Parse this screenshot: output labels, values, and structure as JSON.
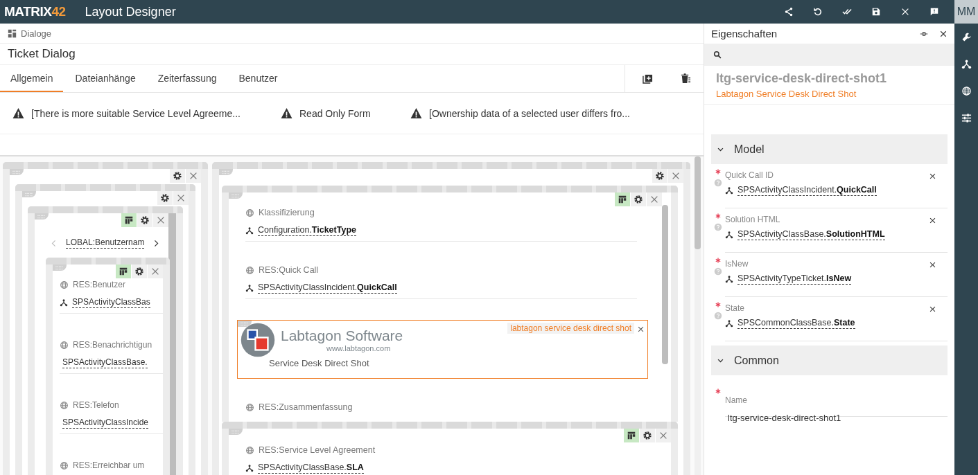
{
  "app_bar": {
    "logo": "MATRIX",
    "logo_accent": "42",
    "title": "Layout Designer",
    "user_initials": "MM"
  },
  "breadcrumb": "Dialoge",
  "dialog_title": "Ticket Dialog",
  "tabs": [
    {
      "label": "Allgemein",
      "selected": true
    },
    {
      "label": "Dateianhänge",
      "selected": false
    },
    {
      "label": "Zeiterfassung",
      "selected": false
    },
    {
      "label": "Benutzer",
      "selected": false
    }
  ],
  "warnings": [
    "[There is more suitable Service Level Agreeme...",
    "Read Only Form",
    "[Ownership data of a selected user differs fro..."
  ],
  "canvas": {
    "left": {
      "carousel_label": "LOBAL:Benutzernam",
      "fields": [
        {
          "kind": "model",
          "label": "RES:Benutzer",
          "binding": "SPSActivityClassBas"
        },
        {
          "kind": "text",
          "label": "RES:Benachrichtigun",
          "binding": "SPSActivityClassBase."
        },
        {
          "kind": "text",
          "label": "RES:Telefon",
          "binding": "SPSActivityClassIncide"
        },
        {
          "kind": "text",
          "label": "RES:Erreichbar um"
        }
      ]
    },
    "right": {
      "fields": [
        {
          "kind": "field",
          "label": "Klassifizierung",
          "binding": "Configuration.**TicketType**"
        },
        {
          "kind": "field",
          "label": "RES:Quick Call",
          "binding": "SPSActivityClassIncident.**QuickCall**"
        },
        {
          "kind": "image",
          "selected": true,
          "tag": "labtagon service desk direct shot",
          "logo_name": "Labtagon Software",
          "logo_url": "www.labtagon.com",
          "caption": "Service Desk Direct Shot"
        },
        {
          "kind": "field",
          "label": "RES:Zusammenfassung"
        }
      ],
      "lower_fields": [
        {
          "kind": "field",
          "label": "RES:Service Level Agreement",
          "binding": "SPSActivityClassBase.**SLA**"
        }
      ]
    }
  },
  "properties": {
    "title": "Eigenschaften",
    "element_name": "ltg-service-desk-direct-shot1",
    "element_type": "Labtagon Service Desk Direct Shot",
    "sections": [
      {
        "title": "Model",
        "expanded": true,
        "items": [
          {
            "kind": "binding",
            "label": "Quick Call ID",
            "required": true,
            "binding": "SPSActivityClassIncident.**QuickCall**"
          },
          {
            "kind": "binding",
            "label": "Solution HTML",
            "required": true,
            "binding": "SPSActivityClassBase.**SolutionHTML**"
          },
          {
            "kind": "binding",
            "label": "IsNew",
            "required": true,
            "binding": "SPSActivityTypeTicket.**IsNew**"
          },
          {
            "kind": "binding",
            "label": "State",
            "required": true,
            "binding": "SPSCommonClassBase.**State**"
          }
        ]
      },
      {
        "title": "Common",
        "expanded": true,
        "items": [
          {
            "kind": "text",
            "label": "Name",
            "required": true,
            "value": "ltg-service-desk-direct-shot1"
          }
        ]
      }
    ]
  }
}
